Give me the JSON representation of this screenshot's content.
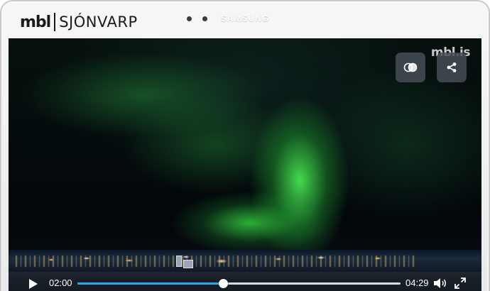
{
  "header": {
    "logo_mbl": "mbl",
    "logo_sjonvarp": "SJÓNVARP",
    "device_brand": "SAMSUNG"
  },
  "video": {
    "watermark": "mbl.is",
    "overlay_buttons": [
      {
        "icon": "overlap-circles-icon"
      },
      {
        "icon": "share-icon"
      }
    ]
  },
  "player": {
    "current_time": "02:00",
    "total_time": "04:29",
    "progress": 0.45,
    "accent_color": "#2aa8ea",
    "controls": [
      "play-icon",
      "volume-icon",
      "fullscreen-icon"
    ]
  }
}
